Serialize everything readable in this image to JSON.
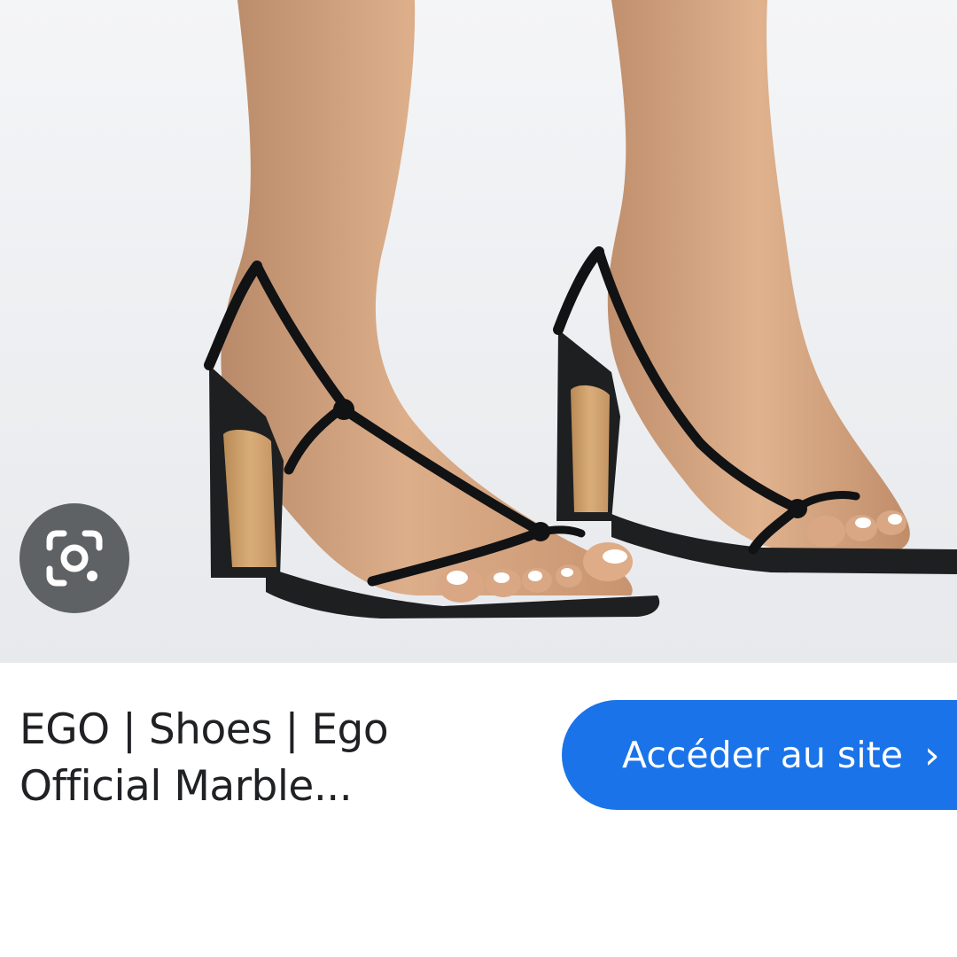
{
  "product_image": {
    "alt": "",
    "background_color": "#eef0f3"
  },
  "lens_button": {
    "icon": "google-lens-icon",
    "background_color": "#5f6265"
  },
  "result": {
    "title_line_1": "EGO | Shoes | Ego",
    "title_line_2": "Official Marble..."
  },
  "visit_button": {
    "label": "Accéder au site",
    "chevron": "›",
    "color": "#1a73e8"
  }
}
